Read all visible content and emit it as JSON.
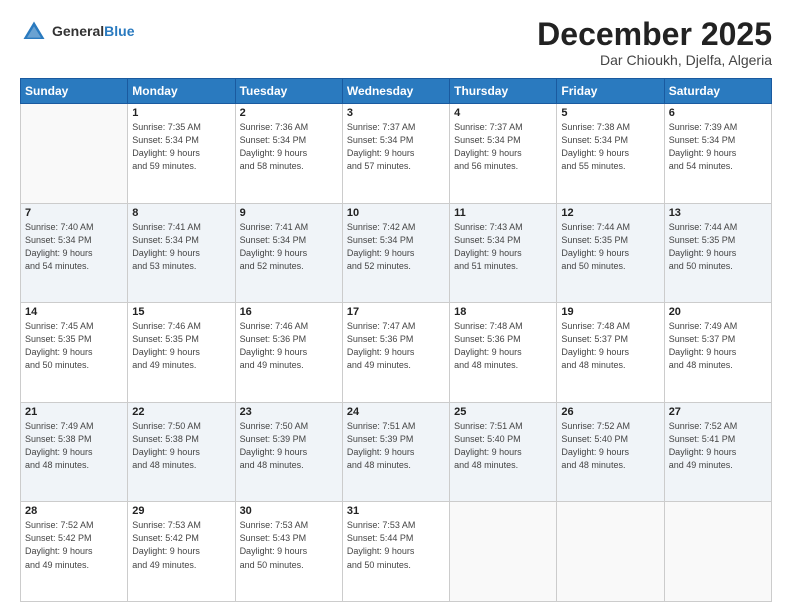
{
  "header": {
    "logo_general": "General",
    "logo_blue": "Blue",
    "month_title": "December 2025",
    "location": "Dar Chioukh, Djelfa, Algeria"
  },
  "days_of_week": [
    "Sunday",
    "Monday",
    "Tuesday",
    "Wednesday",
    "Thursday",
    "Friday",
    "Saturday"
  ],
  "weeks": [
    [
      {
        "day": "",
        "info": ""
      },
      {
        "day": "1",
        "info": "Sunrise: 7:35 AM\nSunset: 5:34 PM\nDaylight: 9 hours\nand 59 minutes."
      },
      {
        "day": "2",
        "info": "Sunrise: 7:36 AM\nSunset: 5:34 PM\nDaylight: 9 hours\nand 58 minutes."
      },
      {
        "day": "3",
        "info": "Sunrise: 7:37 AM\nSunset: 5:34 PM\nDaylight: 9 hours\nand 57 minutes."
      },
      {
        "day": "4",
        "info": "Sunrise: 7:37 AM\nSunset: 5:34 PM\nDaylight: 9 hours\nand 56 minutes."
      },
      {
        "day": "5",
        "info": "Sunrise: 7:38 AM\nSunset: 5:34 PM\nDaylight: 9 hours\nand 55 minutes."
      },
      {
        "day": "6",
        "info": "Sunrise: 7:39 AM\nSunset: 5:34 PM\nDaylight: 9 hours\nand 54 minutes."
      }
    ],
    [
      {
        "day": "7",
        "info": "Sunrise: 7:40 AM\nSunset: 5:34 PM\nDaylight: 9 hours\nand 54 minutes."
      },
      {
        "day": "8",
        "info": "Sunrise: 7:41 AM\nSunset: 5:34 PM\nDaylight: 9 hours\nand 53 minutes."
      },
      {
        "day": "9",
        "info": "Sunrise: 7:41 AM\nSunset: 5:34 PM\nDaylight: 9 hours\nand 52 minutes."
      },
      {
        "day": "10",
        "info": "Sunrise: 7:42 AM\nSunset: 5:34 PM\nDaylight: 9 hours\nand 52 minutes."
      },
      {
        "day": "11",
        "info": "Sunrise: 7:43 AM\nSunset: 5:34 PM\nDaylight: 9 hours\nand 51 minutes."
      },
      {
        "day": "12",
        "info": "Sunrise: 7:44 AM\nSunset: 5:35 PM\nDaylight: 9 hours\nand 50 minutes."
      },
      {
        "day": "13",
        "info": "Sunrise: 7:44 AM\nSunset: 5:35 PM\nDaylight: 9 hours\nand 50 minutes."
      }
    ],
    [
      {
        "day": "14",
        "info": "Sunrise: 7:45 AM\nSunset: 5:35 PM\nDaylight: 9 hours\nand 50 minutes."
      },
      {
        "day": "15",
        "info": "Sunrise: 7:46 AM\nSunset: 5:35 PM\nDaylight: 9 hours\nand 49 minutes."
      },
      {
        "day": "16",
        "info": "Sunrise: 7:46 AM\nSunset: 5:36 PM\nDaylight: 9 hours\nand 49 minutes."
      },
      {
        "day": "17",
        "info": "Sunrise: 7:47 AM\nSunset: 5:36 PM\nDaylight: 9 hours\nand 49 minutes."
      },
      {
        "day": "18",
        "info": "Sunrise: 7:48 AM\nSunset: 5:36 PM\nDaylight: 9 hours\nand 48 minutes."
      },
      {
        "day": "19",
        "info": "Sunrise: 7:48 AM\nSunset: 5:37 PM\nDaylight: 9 hours\nand 48 minutes."
      },
      {
        "day": "20",
        "info": "Sunrise: 7:49 AM\nSunset: 5:37 PM\nDaylight: 9 hours\nand 48 minutes."
      }
    ],
    [
      {
        "day": "21",
        "info": "Sunrise: 7:49 AM\nSunset: 5:38 PM\nDaylight: 9 hours\nand 48 minutes."
      },
      {
        "day": "22",
        "info": "Sunrise: 7:50 AM\nSunset: 5:38 PM\nDaylight: 9 hours\nand 48 minutes."
      },
      {
        "day": "23",
        "info": "Sunrise: 7:50 AM\nSunset: 5:39 PM\nDaylight: 9 hours\nand 48 minutes."
      },
      {
        "day": "24",
        "info": "Sunrise: 7:51 AM\nSunset: 5:39 PM\nDaylight: 9 hours\nand 48 minutes."
      },
      {
        "day": "25",
        "info": "Sunrise: 7:51 AM\nSunset: 5:40 PM\nDaylight: 9 hours\nand 48 minutes."
      },
      {
        "day": "26",
        "info": "Sunrise: 7:52 AM\nSunset: 5:40 PM\nDaylight: 9 hours\nand 48 minutes."
      },
      {
        "day": "27",
        "info": "Sunrise: 7:52 AM\nSunset: 5:41 PM\nDaylight: 9 hours\nand 49 minutes."
      }
    ],
    [
      {
        "day": "28",
        "info": "Sunrise: 7:52 AM\nSunset: 5:42 PM\nDaylight: 9 hours\nand 49 minutes."
      },
      {
        "day": "29",
        "info": "Sunrise: 7:53 AM\nSunset: 5:42 PM\nDaylight: 9 hours\nand 49 minutes."
      },
      {
        "day": "30",
        "info": "Sunrise: 7:53 AM\nSunset: 5:43 PM\nDaylight: 9 hours\nand 50 minutes."
      },
      {
        "day": "31",
        "info": "Sunrise: 7:53 AM\nSunset: 5:44 PM\nDaylight: 9 hours\nand 50 minutes."
      },
      {
        "day": "",
        "info": ""
      },
      {
        "day": "",
        "info": ""
      },
      {
        "day": "",
        "info": ""
      }
    ]
  ]
}
